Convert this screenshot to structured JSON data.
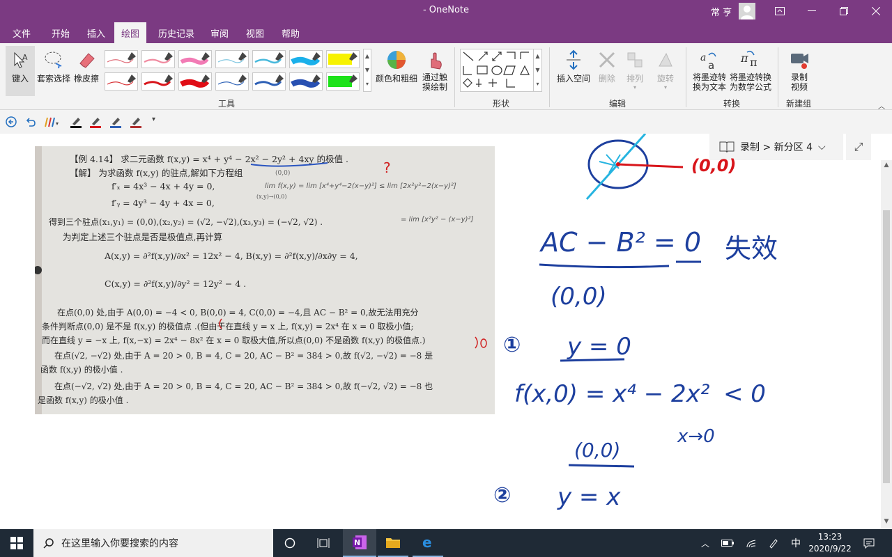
{
  "titlebar": {
    "title": "-  OneNote",
    "user": "常 亨"
  },
  "tabs": [
    "文件",
    "开始",
    "插入",
    "绘图",
    "历史记录",
    "审阅",
    "视图",
    "帮助"
  ],
  "ribbon": {
    "type_label": "键入",
    "lasso_label": "套索选择",
    "eraser_label": "橡皮擦",
    "color_label": "颜色和粗细",
    "touch_label1": "通过触",
    "touch_label2": "摸绘制",
    "tools_group": "工具",
    "shapes_group": "形状",
    "insert_space_label": "插入空间",
    "delete_label": "删除",
    "arrange_label": "排列",
    "rotate_label": "旋转",
    "edit_group": "编辑",
    "ink_to_text1": "将墨迹转",
    "ink_to_text2": "换为文本",
    "ink_to_math1": "将墨迹转换",
    "ink_to_math2": "为数学公式",
    "convert_group": "转换",
    "record_label1": "录制",
    "record_label2": "视频",
    "newgroup_group": "新建组",
    "pen_colors": [
      "#e06d79",
      "#f08aa0",
      "#f27bb5",
      "#7fc6e0",
      "#48b9dc",
      "#1ab0ea",
      "#f7f200",
      "#d83236",
      "#d8151b",
      "#e00d16",
      "#3366b8",
      "#2d5fb5",
      "#2850b2",
      "#1de21a"
    ]
  },
  "breadcrumb": {
    "text": "录制 > 新分区 4"
  },
  "scan": {
    "l1": "【例 4.14】  求二元函数 f(x,y) = x⁴ + y⁴ − 2x² − 2y² + 4xy 的极值 .",
    "l2": "【解】  为求函数 f(x,y) 的驻点,解如下方程组",
    "l2b": "(0,0)",
    "l3": "f′ₓ = 4x³ − 4x + 4y = 0,",
    "l4": "f′ᵧ = 4y³ − 4y + 4x = 0,",
    "lim1": "lim f(x,y) = lim [x⁴+y⁴−2(x−y)²] ≤ lim [2x²y²−2(x−y)²]",
    "lim2": "(x,y)→(0,0)",
    "l5": "得到三个驻点(x₁,y₁) = (0,0),(x₂,y₂) = (√2, −√2),(x₃,y₃) = (−√2, √2) .",
    "lim3": "= lim [x²y² − (x−y)²]",
    "l6": "为判定上述三个驻点是否是极值点,再计算",
    "l7": "A(x,y) = ∂²f(x,y)/∂x² = 12x² − 4,   B(x,y) = ∂²f(x,y)/∂x∂y = 4,",
    "l8": "C(x,y) = ∂²f(x,y)/∂y² = 12y² − 4 .",
    "l9": "在点(0,0) 处,由于 A(0,0) = −4 < 0, B(0,0) = 4, C(0,0) = −4,且 AC − B² = 0,故无法用充分",
    "l10": "条件判断点(0,0) 是不是 f(x,y) 的极值点 .(但由于在直线 y = x 上, f(x,y) = 2x⁴ 在 x = 0 取极小值;",
    "l11": "而在直线 y = −x 上, f(x,−x) = 2x⁴ − 8x² 在 x = 0 取极大值,所以点(0,0) 不是函数 f(x,y) 的极值点.)",
    "l12": "在点(√2, −√2) 处,由于 A = 20 > 0, B = 4, C = 20, AC − B² = 384 > 0,故 f(√2, −√2) = −8 是",
    "l13": "函数 f(x,y) 的极小值 .",
    "l14": "在点(−√2, √2) 处,由于 A = 20 > 0, B = 4, C = 20, AC − B² = 384 > 0,故 f(−√2, √2) = −8 也",
    "l15": "是函数 f(x,y) 的极小值 ."
  },
  "ink": {
    "origin_label": "(0,0)",
    "h1": "AC − B² = 0",
    "h1b": "失效",
    "h2": "(0,0)",
    "n1": "①",
    "h3": "y = 0",
    "h4": "f(x,0) = x⁴ − 2x²",
    "h4b": "< 0",
    "h5": "x→0",
    "h6": "(0,0)",
    "n2": "②",
    "h7": "y = x"
  },
  "taskbar": {
    "search_placeholder": "在这里输入你要搜索的内容",
    "ime": "中",
    "time": "13:23",
    "date": "2020/9/22"
  }
}
